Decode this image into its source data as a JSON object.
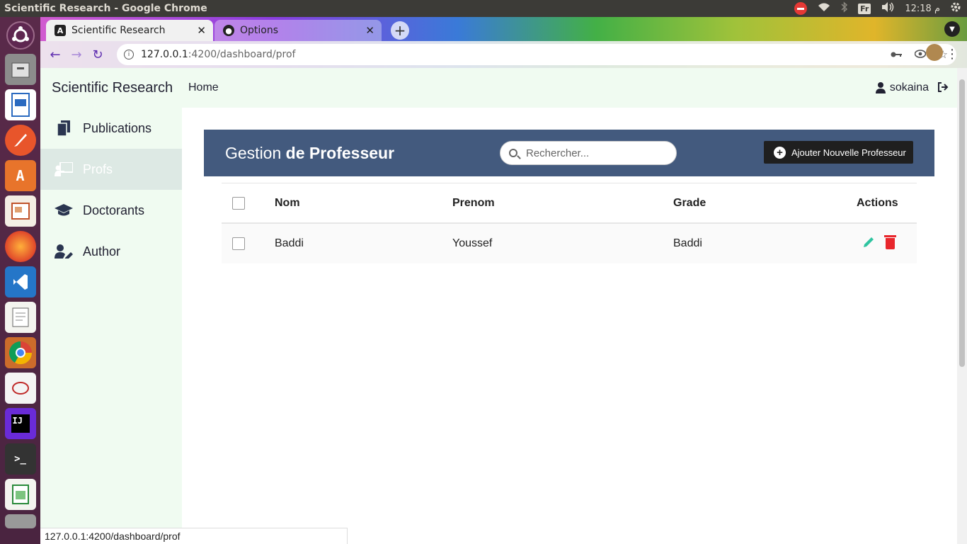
{
  "os": {
    "window_title": "Scientific Research - Google Chrome",
    "keyboard_layout": "Fr",
    "clock": "12:18 م"
  },
  "launcher": {
    "items": [
      "ubuntu-icon",
      "files-icon",
      "writer-icon",
      "inkscape-icon",
      "software-icon",
      "impress-icon",
      "firefox-icon",
      "vscode-icon",
      "text-editor-icon",
      "chrome-icon",
      "evince-icon",
      "intellij-icon",
      "terminal-icon",
      "calc-icon",
      "trash-icon"
    ]
  },
  "browser": {
    "tabs": [
      {
        "label": "Scientific Research",
        "favicon": "angular-icon",
        "active": true
      },
      {
        "label": "Options",
        "favicon": "github-icon",
        "active": false
      }
    ],
    "url_host": "127.0.0.1",
    "url_path": ":4200/dashboard/prof",
    "status_url": "127.0.0.1:4200/dashboard/prof"
  },
  "app": {
    "brand": "Scientific Research",
    "home_link": "Home",
    "username": "sokaina",
    "sidebar": [
      {
        "label": "Publications",
        "icon": "copy-icon",
        "active": false
      },
      {
        "label": "Profs",
        "icon": "chalkboard-teacher-icon",
        "active": true
      },
      {
        "label": "Doctorants",
        "icon": "graduation-cap-icon",
        "active": false
      },
      {
        "label": "Author",
        "icon": "user-edit-icon",
        "active": false
      }
    ],
    "panel": {
      "title_light": "Gestion",
      "title_bold": "de Professeur",
      "search_placeholder": "Rechercher...",
      "add_button": "Ajouter Nouvelle Professeur"
    },
    "table": {
      "headers": {
        "nom": "Nom",
        "prenom": "Prenom",
        "grade": "Grade",
        "actions": "Actions"
      },
      "rows": [
        {
          "nom": "Baddi",
          "prenom": "Youssef",
          "grade": "Baddi"
        }
      ]
    },
    "colors": {
      "panel_header": "#435a7e",
      "edit": "#2ec4a0",
      "delete": "#e8262c",
      "sidebar_bg": "#f0fbf1"
    }
  }
}
